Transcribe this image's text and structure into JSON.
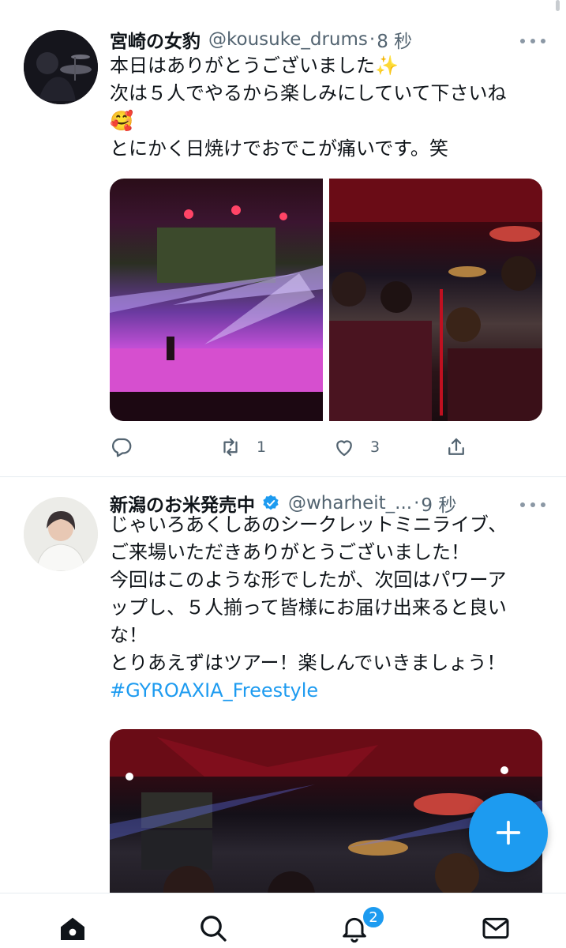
{
  "colors": {
    "accent": "#1d9bf0",
    "text_primary": "#0f1419",
    "text_secondary": "#536471",
    "divider": "#e6ecf0"
  },
  "tweets": [
    {
      "display_name": "宮崎の女豹",
      "handle": "@kousuke_drums",
      "separator": "·",
      "time": "8 秒",
      "verified": false,
      "lines": [
        "本日はありがとうございました✨",
        "次は５人でやるから楽しみにしていて下さいね",
        "🥰",
        "とにかく日焼けでおでこが痛いです。笑"
      ],
      "hashtag": "",
      "media": [
        "stage-photo",
        "band-group-photo"
      ],
      "actions": {
        "reply_icon": "reply-icon",
        "retweet_icon": "retweet-icon",
        "retweet_count": "1",
        "like_icon": "heart-icon",
        "like_count": "3",
        "share_icon": "share-icon"
      }
    },
    {
      "display_name": "新潟のお米発売中",
      "handle": "@wharheit_...",
      "separator": "·",
      "time": "9 秒",
      "verified": true,
      "lines": [
        "じゃいろあくしあのシークレットミニライブ、",
        "ご来場いただきありがとうございました！",
        "今回はこのような形でしたが、次回はパワーア",
        "ップし、５人揃って皆様にお届け出来ると良い",
        "な！",
        "とりあえずはツアー！楽しんでいきましょう！"
      ],
      "hashtag": "#GYROAXIA_Freestyle",
      "media": [
        "band-group-photo-large"
      ]
    }
  ],
  "fab": {
    "icon": "plus-icon"
  },
  "bottom_nav": {
    "items": [
      "home-icon",
      "search-icon",
      "bell-icon",
      "mail-icon"
    ],
    "notification_badge": "2"
  }
}
